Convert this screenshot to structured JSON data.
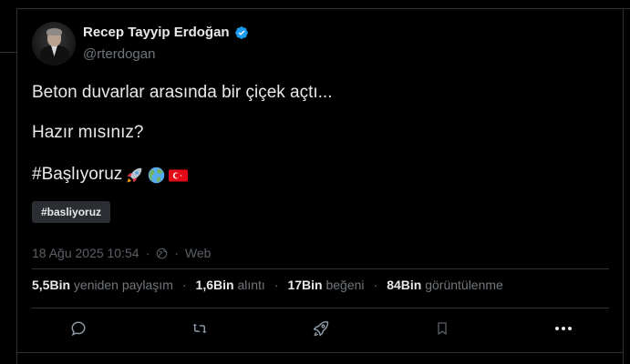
{
  "author": {
    "display_name": "Recep Tayyip Erdoğan",
    "handle": "@rterdogan",
    "verified_color": "#1d9bf0"
  },
  "tweet": {
    "line1": "Beton duvarlar arasında bir çiçek açtı...",
    "line2": "Hazır mısınız?",
    "hashtag_text": "#Başlıyoruz",
    "emojis": [
      "rocket-emoji",
      "globe-earth-emoji",
      "turkish-flag-emoji"
    ]
  },
  "hashtag_chip": "#basliyoruz",
  "meta": {
    "date": "18 Ağu 2025 10:54",
    "sep1": "·",
    "sep2": "·",
    "source": "Web"
  },
  "stats": {
    "reposts_count": "5,5Bin",
    "reposts_label": "yeniden paylaşım",
    "quotes_count": "1,6Bin",
    "quotes_label": "alıntı",
    "likes_count": "17Bin",
    "likes_label": "beğeni",
    "views_count": "84Bin",
    "views_label": "görüntülenme",
    "separator": "·"
  },
  "actions": [
    "reply-icon",
    "repost-icon",
    "boost-icon",
    "bookmark-icon",
    "more-icon"
  ],
  "colors": {
    "background": "#000000",
    "text": "#e7e9ea",
    "muted": "#71767b",
    "border": "#2f3336",
    "accent": "#1d9bf0"
  }
}
